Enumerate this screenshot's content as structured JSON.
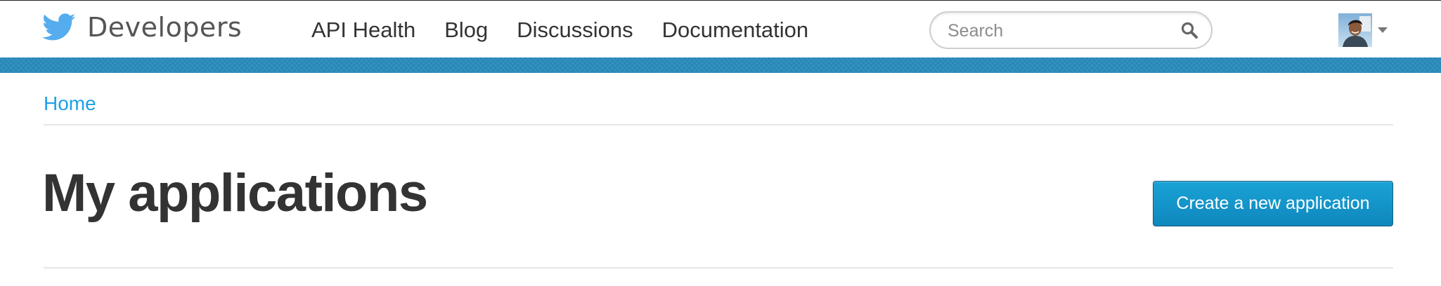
{
  "header": {
    "brand_text": "Developers",
    "nav": [
      {
        "label": "API Health"
      },
      {
        "label": "Blog"
      },
      {
        "label": "Discussions"
      },
      {
        "label": "Documentation"
      }
    ],
    "search": {
      "placeholder": "Search",
      "value": "",
      "icon": "search-icon"
    },
    "user": {
      "avatar_icon": "user-avatar",
      "menu_icon": "caret-down-icon"
    }
  },
  "breadcrumb": {
    "home": "Home"
  },
  "main": {
    "title": "My applications",
    "create_button": "Create a new application"
  },
  "colors": {
    "brand_blue": "#55acee",
    "stripe": "#2a8cbd",
    "link": "#1da0e6",
    "button": "#1496c8",
    "text_dark": "#333333"
  }
}
